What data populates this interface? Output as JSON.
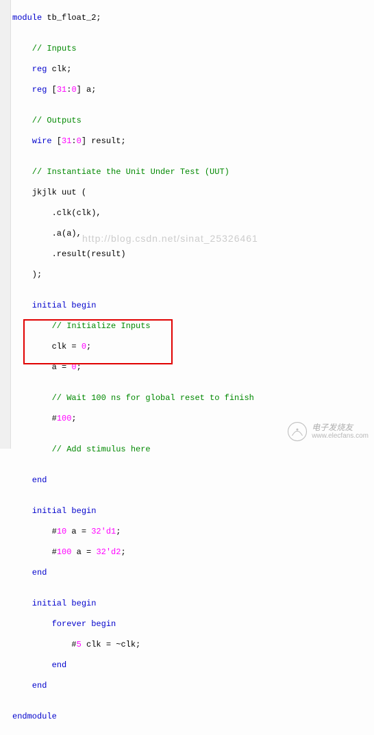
{
  "code": {
    "l1_kw": "module",
    "l1_id": " tb_float_2;",
    "l2": "",
    "l3_cm": "    // Inputs",
    "l4_kw": "    reg",
    "l4_id": " clk;",
    "l5_kw": "    reg",
    "l5_id": " [",
    "l5_n1": "31",
    "l5_c1": ":",
    "l5_n2": "0",
    "l5_id2": "] a;",
    "l6": "",
    "l7_cm": "    // Outputs",
    "l8_kw": "    wire",
    "l8_id": " [",
    "l8_n1": "31",
    "l8_c1": ":",
    "l8_n2": "0",
    "l8_id2": "] result;",
    "l9": "",
    "l10_cm": "    // Instantiate the Unit Under Test (UUT)",
    "l11": "    jkjlk uut (",
    "l12": "        .clk(clk),",
    "l13": "        .a(a),",
    "l14": "        .result(result)",
    "l15": "    );",
    "l16": "",
    "l17_kw": "    initial begin",
    "l18_cm": "        // Initialize Inputs",
    "l19_a": "        clk = ",
    "l19_n": "0",
    "l19_b": ";",
    "l20_a": "        a = ",
    "l20_n": "0",
    "l20_b": ";",
    "l21": "",
    "l22_cm": "        // Wait 100 ns for global reset to finish",
    "l23_a": "        #",
    "l23_n": "100",
    "l23_b": ";",
    "l24": "",
    "l25_cm": "        // Add stimulus here",
    "l26": "",
    "l27_kw": "    end",
    "l28": "",
    "l29_kw": "    initial begin",
    "l30_a": "        #",
    "l30_n1": "10",
    "l30_b": " a = ",
    "l30_n2": "32'd1",
    "l30_c": ";",
    "l31_a": "        #",
    "l31_n1": "100",
    "l31_b": " a = ",
    "l31_n2": "32'd2",
    "l31_c": ";",
    "l32_kw": "    end",
    "l33": "",
    "l34_kw": "    initial begin",
    "l35_kw": "        forever begin",
    "l36_a": "            #",
    "l36_n": "5",
    "l36_b": " clk = ~clk;",
    "l37_kw": "        end",
    "l38_kw": "    end",
    "l39": "",
    "l40_kw": "endmodule"
  },
  "watermark": "http://blog.csdn.net/sinat_25326461",
  "logo": {
    "cn": "电子发烧友",
    "url": "www.elecfans.com"
  }
}
